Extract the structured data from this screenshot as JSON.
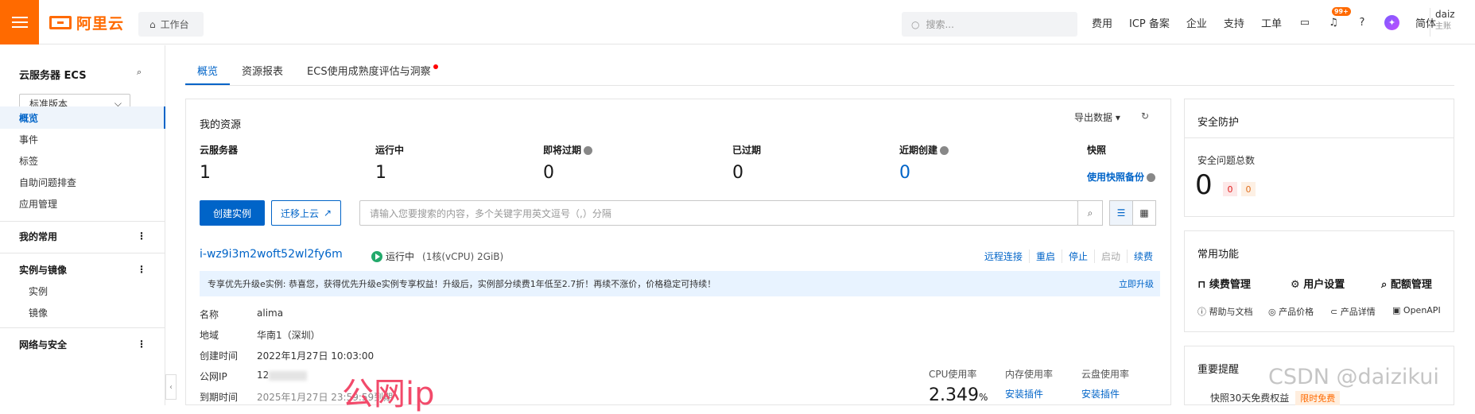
{
  "header": {
    "brand": "阿里云",
    "workbench": "工作台",
    "search_placeholder": "搜索...",
    "nav": [
      "费用",
      "ICP 备案",
      "企业",
      "支持",
      "工单"
    ],
    "notif_badge": "99+",
    "lang": "简体",
    "user_name": "daiz",
    "user_role": "主账"
  },
  "sidebar": {
    "title": "云服务器 ECS",
    "version": "标准版本",
    "items": [
      "概览",
      "事件",
      "标签",
      "自助问题排查",
      "应用管理"
    ],
    "favorites": "我的常用",
    "group_instances": "实例与镜像",
    "sub_items": [
      "实例",
      "镜像"
    ],
    "group_network": "网络与安全"
  },
  "tabs": [
    "概览",
    "资源报表",
    "ECS使用成熟度评估与洞察"
  ],
  "resources": {
    "title": "我的资源",
    "export": "导出数据",
    "stats": [
      {
        "label": "云服务器",
        "value": "1"
      },
      {
        "label": "运行中",
        "value": "1"
      },
      {
        "label": "即将过期",
        "value": "0"
      },
      {
        "label": "已过期",
        "value": "0"
      },
      {
        "label": "近期创建",
        "value": "0"
      }
    ],
    "snapshot_label": "快照",
    "snapshot_link": "使用快照备份",
    "create_btn": "创建实例",
    "migrate_btn": "迁移上云",
    "filter_placeholder": "请输入您要搜索的内容，多个关键字用英文逗号（,）分隔"
  },
  "instance": {
    "id": "i-wz9i3m2woft52wl2fy6m",
    "status": "运行中",
    "spec": "(1核(vCPU) 2GiB)",
    "actions": [
      "远程连接",
      "重启",
      "停止",
      "启动",
      "续费"
    ],
    "notice": "专享优先升级e实例: 恭喜您，获得优先升级e实例专享权益！升级后，实例部分续费1年低至2.7折！再续不涨价，价格稳定可持续！",
    "upgrade": "立即升级",
    "details": [
      {
        "label": "名称",
        "value": "alima"
      },
      {
        "label": "地域",
        "value": "华南1（深圳）"
      },
      {
        "label": "创建时间",
        "value": "2022年1月27日 10:03:00"
      },
      {
        "label": "公网IP",
        "value": "12"
      },
      {
        "label": "到期时间",
        "value": "2025年1月27日 23:59:59到期"
      }
    ],
    "metrics": {
      "cpu_label": "CPU使用率",
      "cpu_value": "2.349",
      "cpu_unit": "%",
      "mem_label": "内存使用率",
      "mem_link": "安装插件",
      "disk_label": "云盘使用率",
      "disk_link": "安装插件"
    }
  },
  "annotation": "公网ip",
  "security": {
    "title": "安全防护",
    "total_label": "安全问题总数",
    "total": "0",
    "high": "0",
    "mid": "0"
  },
  "functions": {
    "title": "常用功能",
    "main": [
      "续费管理",
      "用户设置",
      "配额管理"
    ],
    "sub": [
      "帮助与文档",
      "产品价格",
      "产品详情",
      "OpenAPI"
    ]
  },
  "reminder": {
    "title": "重要提醒",
    "item": "快照30天免费权益",
    "tag": "限时免费"
  },
  "watermark": "CSDN @daizikui"
}
